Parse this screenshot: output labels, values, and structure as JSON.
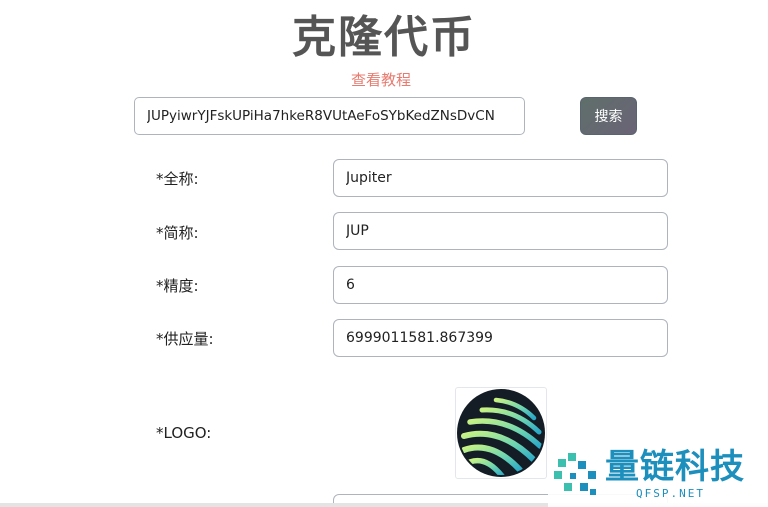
{
  "header": {
    "title": "克隆代币",
    "tutorial_link": "查看教程"
  },
  "search": {
    "value": "JUPyiwrYJFskUPiHa7hkeR8VUtAeFoSYbKedZNsDvCN",
    "button_label": "搜索"
  },
  "form": {
    "full_name": {
      "label": "*全称:",
      "value": "Jupiter"
    },
    "symbol": {
      "label": "*简称:",
      "value": "JUP"
    },
    "decimals": {
      "label": "*精度:",
      "value": "6"
    },
    "supply": {
      "label": "*供应量:",
      "value": "6999011581.867399"
    },
    "logo": {
      "label": "*LOGO:"
    }
  },
  "watermark": {
    "brand": "量链科技",
    "domain": "QFSP.NET",
    "color": "#1c8fbd"
  },
  "colors": {
    "title": "#555555",
    "tutorial": "#e87b6f",
    "border": "#aeb4be"
  }
}
